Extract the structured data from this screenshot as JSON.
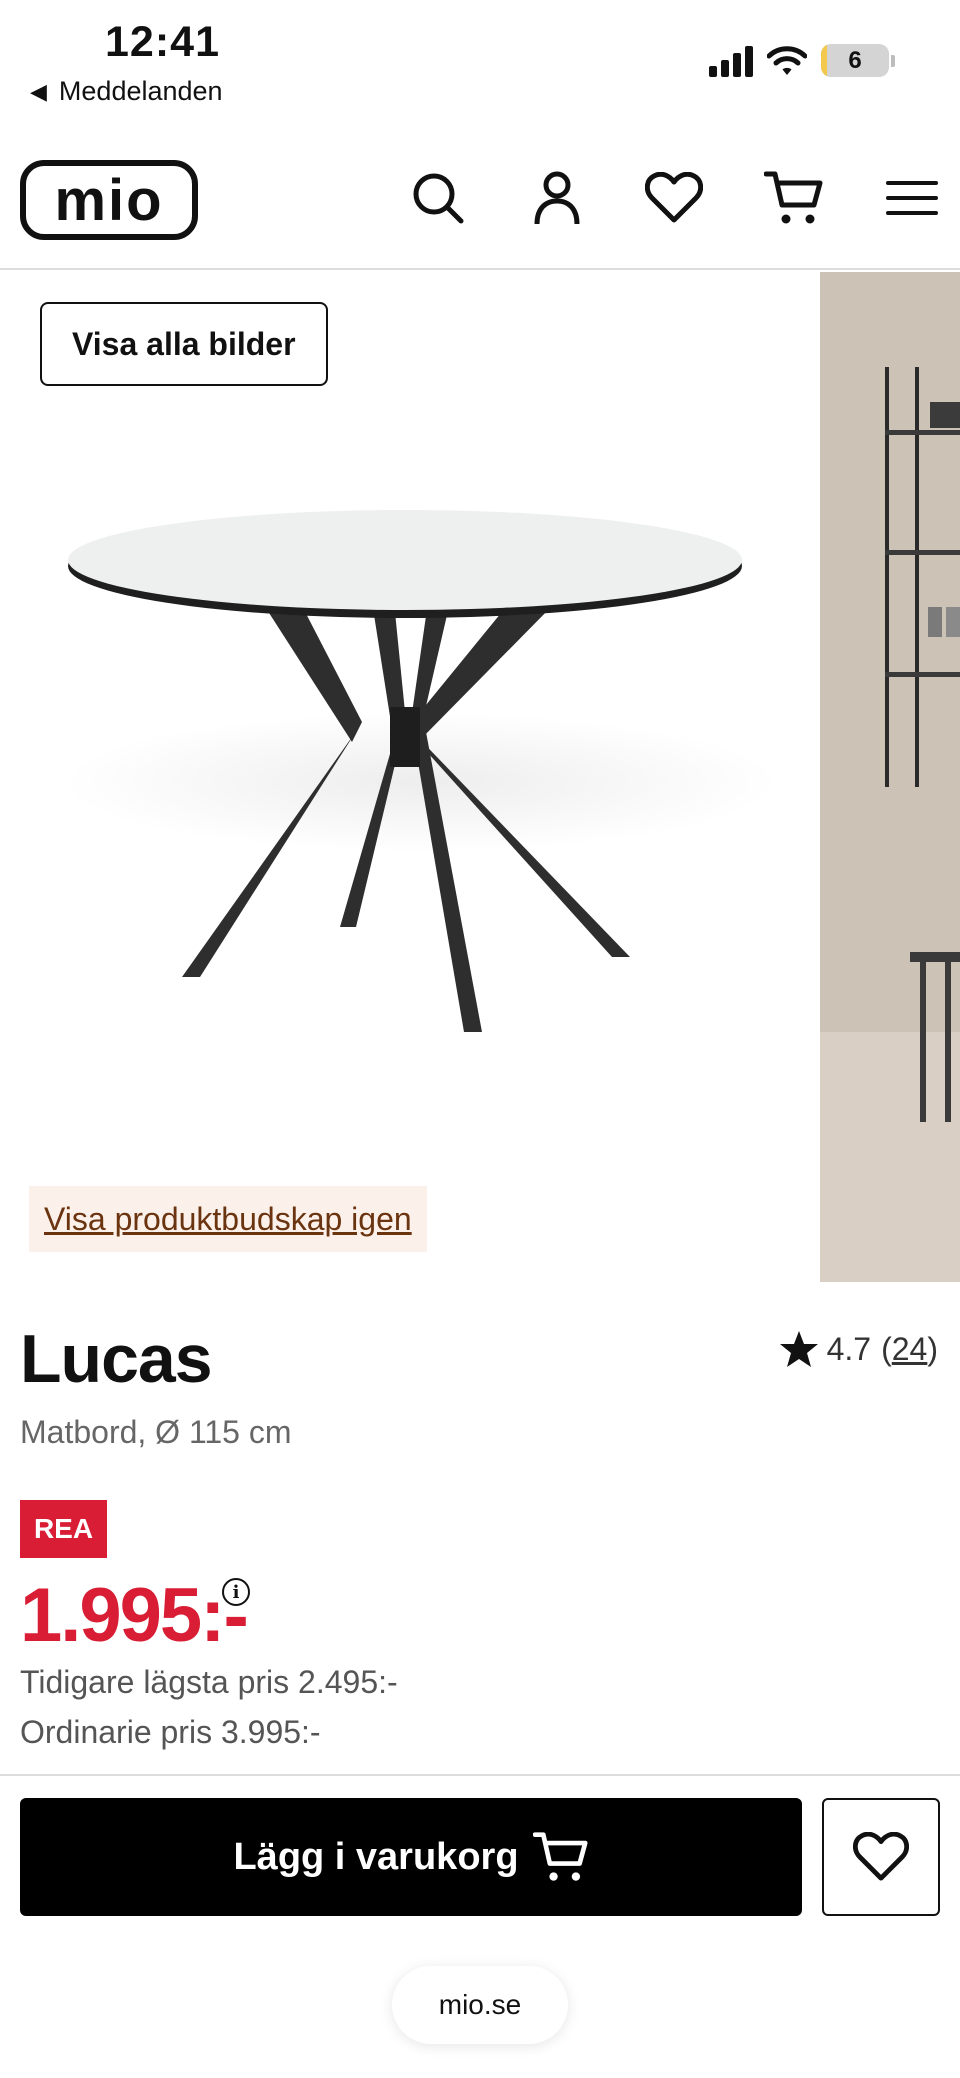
{
  "status_bar": {
    "time": "12:41",
    "back_label": "Meddelanden",
    "battery_level": "6"
  },
  "header": {
    "logo_text": "mio",
    "icons": [
      "search-icon",
      "account-icon",
      "heart-icon",
      "cart-icon",
      "menu-icon"
    ]
  },
  "gallery": {
    "show_all_label": "Visa alla bilder",
    "message_link": "Visa produktbudskap igen"
  },
  "product": {
    "name": "Lucas",
    "subtitle": "Matbord, Ø 115 cm",
    "rating": "4.7",
    "review_count": "24",
    "badge": "REA",
    "price": "1.995:-",
    "previous_lowest": "Tidigare lägsta pris 2.495:-",
    "ordinary_price": "Ordinarie pris 3.995:-"
  },
  "actions": {
    "add_to_cart": "Lägg i varukorg"
  },
  "browser": {
    "url": "mio.se"
  },
  "colors": {
    "sale_red": "#d81d35",
    "button_black": "#000000",
    "link_brown": "#6b3410",
    "message_bg": "#fbf1ea"
  }
}
